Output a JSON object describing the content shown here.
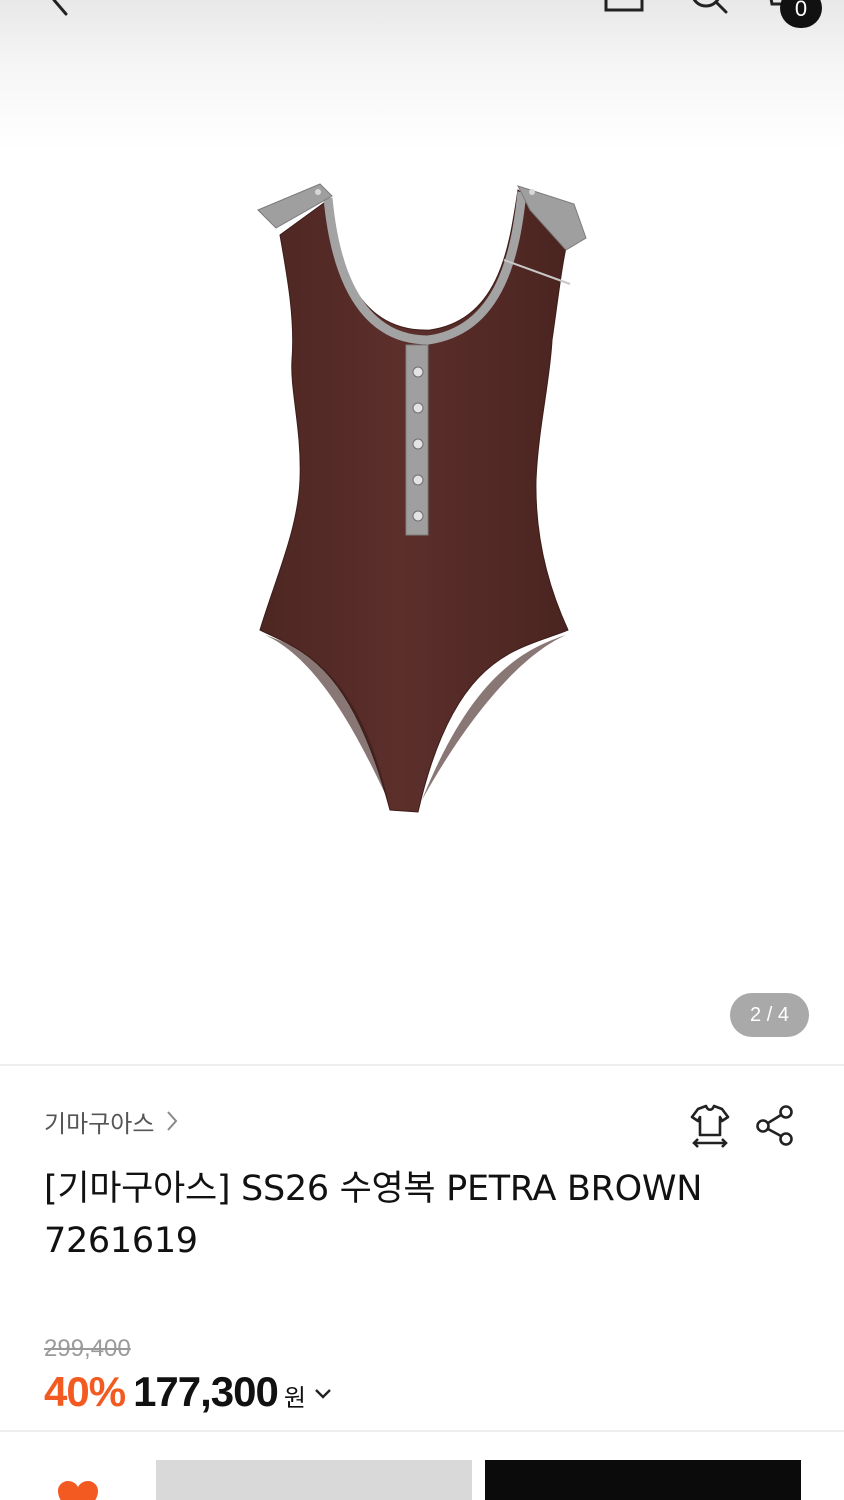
{
  "header": {
    "back_icon": "chevron-left-icon",
    "home_icon": "home-icon",
    "search_icon": "search-icon",
    "cart_icon": "cart-icon",
    "cart_count": "0"
  },
  "gallery": {
    "page_indicator": "2 / 4",
    "product_color": "#5a2e2a",
    "trim_color": "#9a9a9a"
  },
  "product": {
    "brand": "기마구아스",
    "title": "[기마구아스] SS26 수영복 PETRA BROWN 7261619",
    "original_price": "299,400",
    "discount": "40%",
    "price": "177,300",
    "currency": "원"
  },
  "actions": {
    "size_icon": "size-guide-icon",
    "share_icon": "share-icon",
    "heart_icon": "heart-icon"
  },
  "colors": {
    "accent": "#f35a21",
    "buy_button": "#0b0b0b",
    "cart_button": "#d9d9d9"
  }
}
